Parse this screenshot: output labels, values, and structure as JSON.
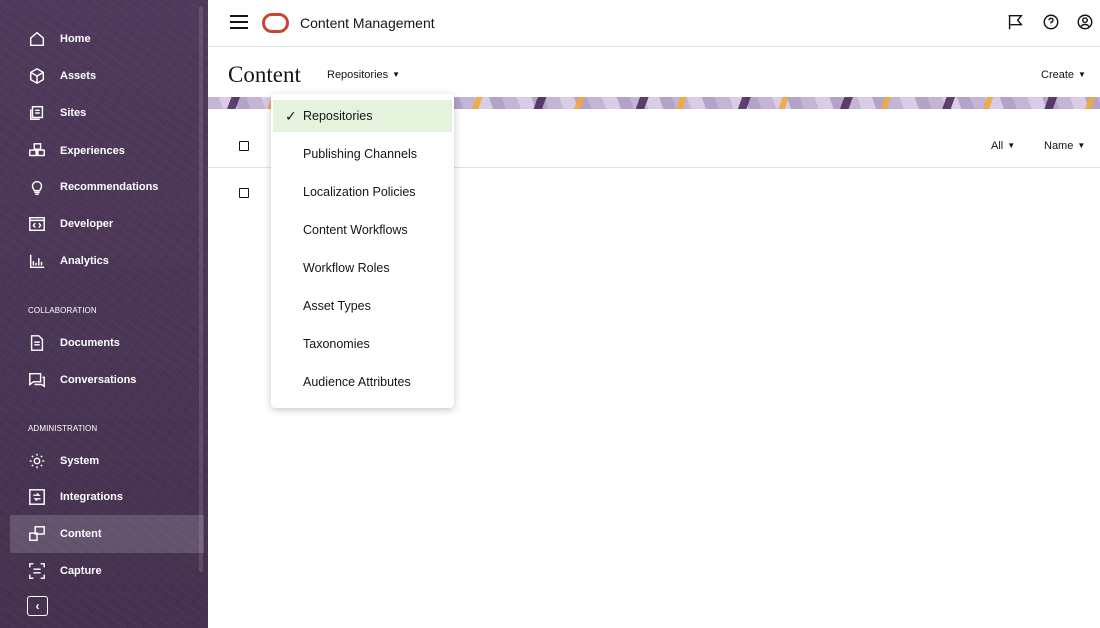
{
  "app": {
    "title": "Content Management"
  },
  "sidebar": {
    "items": [
      {
        "label": "Home",
        "icon": "home-icon"
      },
      {
        "label": "Assets",
        "icon": "cube-icon"
      },
      {
        "label": "Sites",
        "icon": "sites-icon"
      },
      {
        "label": "Experiences",
        "icon": "experiences-icon"
      },
      {
        "label": "Recommendations",
        "icon": "lightbulb-icon"
      },
      {
        "label": "Developer",
        "icon": "code-icon"
      },
      {
        "label": "Analytics",
        "icon": "chart-icon"
      }
    ],
    "collaboration_header": "COLLABORATION",
    "collaboration_items": [
      {
        "label": "Documents",
        "icon": "document-icon"
      },
      {
        "label": "Conversations",
        "icon": "conversation-icon"
      }
    ],
    "administration_header": "ADMINISTRATION",
    "administration_items": [
      {
        "label": "System",
        "icon": "gear-icon"
      },
      {
        "label": "Integrations",
        "icon": "integrations-icon"
      },
      {
        "label": "Content",
        "icon": "content-icon",
        "active": true
      },
      {
        "label": "Capture",
        "icon": "capture-icon"
      }
    ],
    "collapse_glyph": "‹"
  },
  "page": {
    "title": "Content",
    "view_selector": "Repositories",
    "create_label": "Create",
    "filter_all": "All",
    "sort_name": "Name"
  },
  "menu": {
    "items": [
      {
        "label": "Repositories",
        "selected": true
      },
      {
        "label": "Publishing Channels"
      },
      {
        "label": "Localization Policies"
      },
      {
        "label": "Content Workflows"
      },
      {
        "label": "Workflow Roles"
      },
      {
        "label": "Asset Types"
      },
      {
        "label": "Taxonomies"
      },
      {
        "label": "Audience Attributes"
      }
    ],
    "check_glyph": "✓"
  },
  "colors": {
    "sidebar_bg": "#4b3558",
    "brand_red": "#c74634",
    "selected_bg": "#e5f3dd"
  }
}
